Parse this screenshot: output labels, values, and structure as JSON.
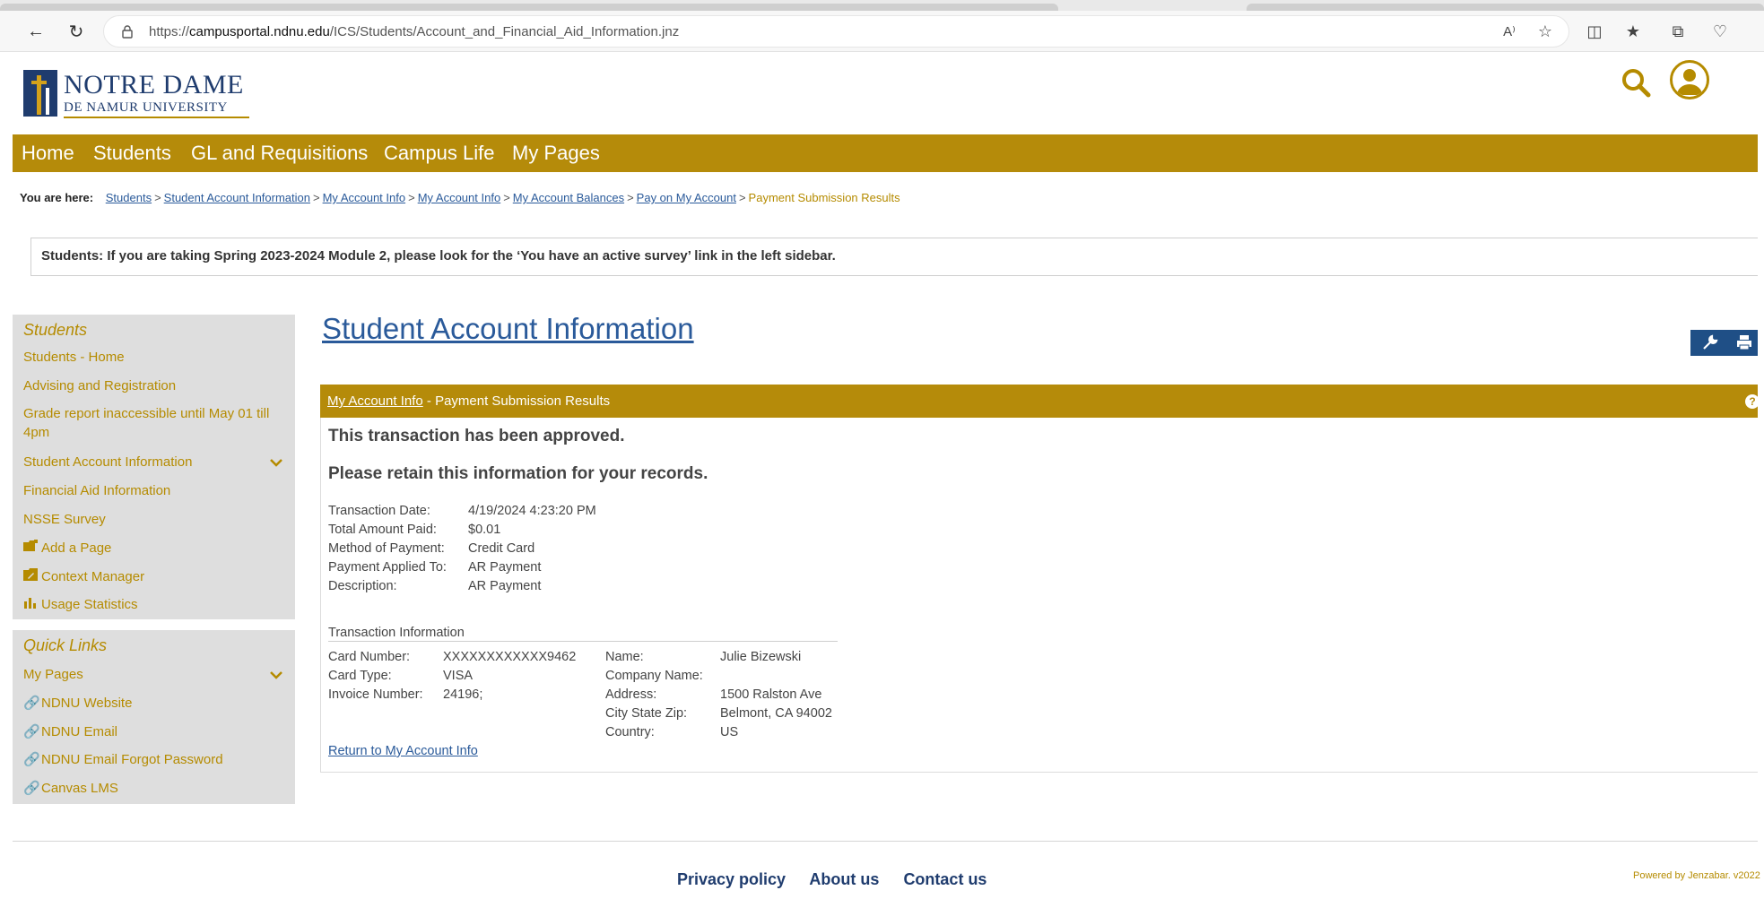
{
  "browser": {
    "url_prefix": "https://",
    "url_host": "campusportal.ndnu.edu",
    "url_path": "/ICS/Students/Account_and_Financial_Aid_Information.jnz",
    "read_aloud_label": "A⁾"
  },
  "logo": {
    "line1": "NOTRE DAME",
    "line2": "DE NAMUR UNIVERSITY"
  },
  "mainnav": [
    "Home",
    "Students",
    "GL and Requisitions",
    "Campus Life",
    "My Pages"
  ],
  "breadcrumb": {
    "label": "You are here:",
    "links": [
      "Students",
      "Student Account Information",
      "My Account Info",
      "My Account Info",
      "My Account Balances",
      "Pay on My Account"
    ],
    "current": "Payment Submission Results"
  },
  "notice": "Students: If you are taking Spring 2023-2024 Module 2, please look for the ‘You have an active survey’ link in the left sidebar.",
  "sidebar": {
    "students_title": "Students",
    "students_items": [
      "Students - Home",
      "Advising and Registration",
      "Grade report inaccessible until May 01 till 4pm",
      "Student Account Information",
      "Financial Aid Information",
      "NSSE Survey"
    ],
    "tools": [
      "Add a Page",
      "Context Manager",
      "Usage Statistics"
    ],
    "quicklinks_title": "Quick Links",
    "quicklinks_items": [
      "My Pages",
      "NDNU Website",
      "NDNU Email",
      "NDNU Email Forgot Password",
      "Canvas LMS"
    ]
  },
  "main": {
    "title": "Student Account Information",
    "panel_link": "My Account Info",
    "panel_suffix": " - Payment Submission Results",
    "help": "?",
    "approved": "This transaction has been approved.",
    "retain": "Please retain this information for your records.",
    "details": [
      {
        "label": "Transaction Date:",
        "value": "4/19/2024 4:23:20 PM"
      },
      {
        "label": "Total Amount Paid:",
        "value": "$0.01"
      },
      {
        "label": "Method of Payment:",
        "value": "Credit Card"
      },
      {
        "label": "Payment Applied To:",
        "value": "AR Payment"
      },
      {
        "label": "Description:",
        "value": "AR Payment"
      }
    ],
    "transaction_info_label": "Transaction Information",
    "card": [
      {
        "label": "Card Number:",
        "value": "XXXXXXXXXXXX9462"
      },
      {
        "label": "Card Type:",
        "value": "VISA"
      },
      {
        "label": "Invoice Number:",
        "value": "24196;"
      }
    ],
    "billing": [
      {
        "label": "Name:",
        "value": "Julie Bizewski"
      },
      {
        "label": "Company Name:",
        "value": ""
      },
      {
        "label": "Address:",
        "value": "1500 Ralston Ave"
      },
      {
        "label": "City State Zip:",
        "value": "Belmont, CA 94002"
      },
      {
        "label": "Country:",
        "value": "US"
      }
    ],
    "return_link": "Return to My Account Info"
  },
  "footer": {
    "links": [
      "Privacy policy",
      "About us",
      "Contact us"
    ],
    "powered": "Powered by Jenzabar. v2022"
  },
  "colors": {
    "gold": "#b58b0a",
    "navy": "#1f3c6e",
    "link": "#2a5a9a"
  }
}
